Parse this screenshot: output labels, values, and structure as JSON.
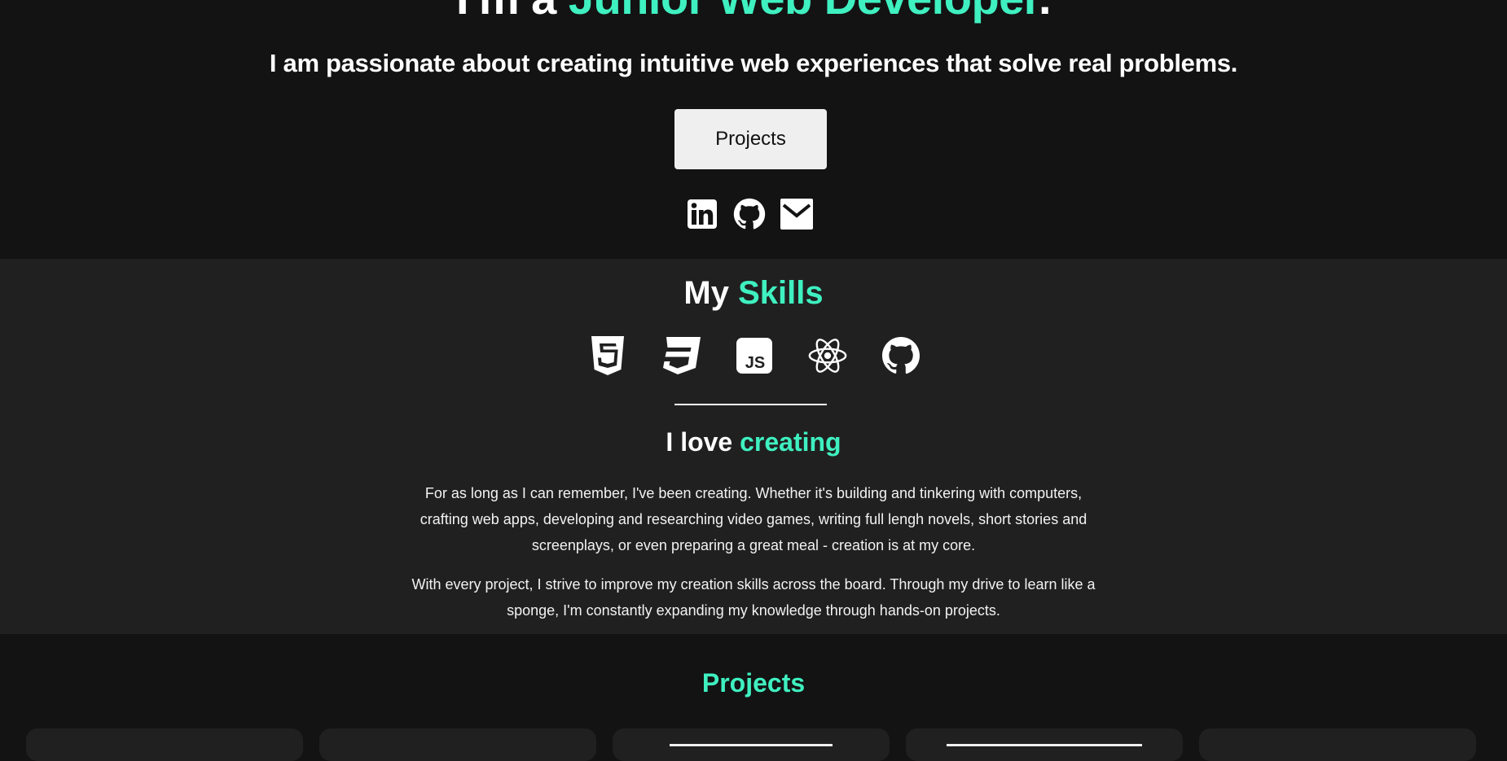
{
  "hero": {
    "title_prefix": "I'm a ",
    "title_accent": "Junior Web Developer",
    "title_suffix": ".",
    "subtitle": "I am passionate about creating intuitive web experiences that solve real problems.",
    "projects_button": "Projects",
    "social_icons": [
      "linkedin-icon",
      "github-icon",
      "email-icon"
    ]
  },
  "skills": {
    "title_prefix": "My ",
    "title_accent": "Skills",
    "icons": [
      "html5-icon",
      "css3-icon",
      "javascript-icon",
      "react-icon",
      "github-icon"
    ],
    "love_prefix": "I love ",
    "love_accent": "creating",
    "paragraph1": "For as long as I can remember, I've been creating. Whether it's building and tinkering with computers, crafting web apps, developing and researching video games, writing full lengh novels, short stories and screenplays, or even preparing a great meal - creation is at my core.",
    "paragraph2": "With every project, I strive to improve my creation skills across the board. Through my drive to learn like a sponge, I'm constantly expanding my knowledge through hands-on projects."
  },
  "projects": {
    "title": "Projects"
  },
  "colors": {
    "accent": "#3ff0c0",
    "background": "#131313",
    "section_alt": "#202020",
    "button_bg": "#efefef"
  }
}
